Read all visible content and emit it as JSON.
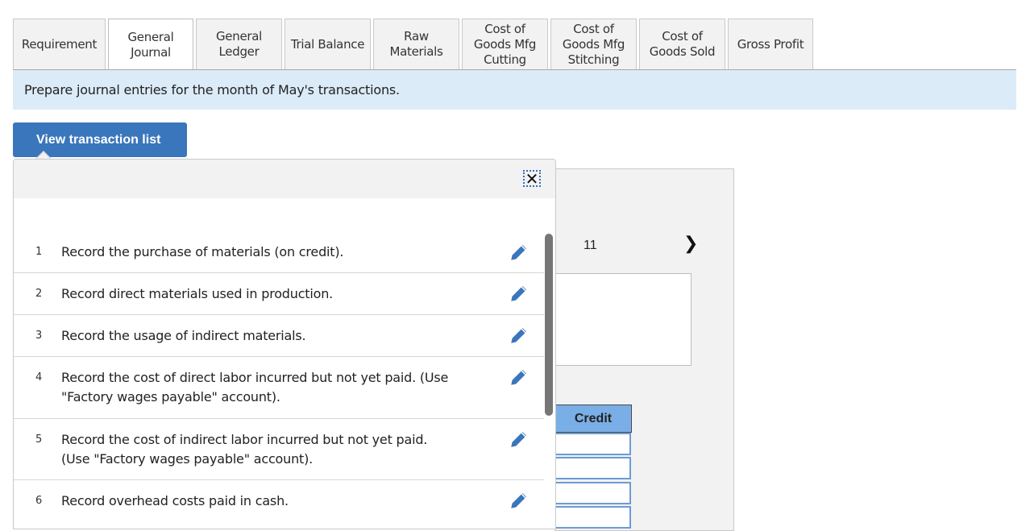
{
  "tabs": [
    {
      "label": "Requirement",
      "active": false
    },
    {
      "label": "General\nJournal",
      "active": true
    },
    {
      "label": "General\nLedger",
      "active": false
    },
    {
      "label": "Trial Balance",
      "active": false
    },
    {
      "label": "Raw\nMaterials",
      "active": false
    },
    {
      "label": "Cost of\nGoods Mfg\nCutting",
      "active": false
    },
    {
      "label": "Cost of\nGoods Mfg\nStitching",
      "active": false
    },
    {
      "label": "Cost of\nGoods Sold",
      "active": false
    },
    {
      "label": "Gross Profit",
      "active": false
    }
  ],
  "instruction": "Prepare journal entries for the month of May's transactions.",
  "view_transaction_button": "View transaction list",
  "popup": {
    "close_icon": "close-icon",
    "transactions": [
      {
        "number": "1",
        "text": "Record the purchase of materials (on credit).",
        "icon": "pencil-icon"
      },
      {
        "number": "2",
        "text": "Record direct materials used in production.",
        "icon": "pencil-icon"
      },
      {
        "number": "3",
        "text": "Record the usage of indirect materials.",
        "icon": "pencil-icon"
      },
      {
        "number": "4",
        "text": "Record the cost of direct labor incurred but not yet paid. (Use \"Factory wages payable\" account).",
        "icon": "pencil-icon"
      },
      {
        "number": "5",
        "text": "Record the cost of indirect labor incurred but not yet paid. (Use \"Factory wages payable\" account).",
        "icon": "pencil-icon"
      },
      {
        "number": "6",
        "text": "Record overhead costs paid in cash.",
        "icon": "pencil-icon"
      }
    ]
  },
  "worksheet": {
    "page_number": "11",
    "next_icon": "chevron-right-icon",
    "credit_header": "Credit",
    "credit_values": [
      "",
      "",
      "",
      ""
    ]
  },
  "colors": {
    "accent": "#3a76bb",
    "instruction_bg": "#dbebf8",
    "credit_header_bg": "#7aaee6",
    "scrollbar": "#767676"
  }
}
